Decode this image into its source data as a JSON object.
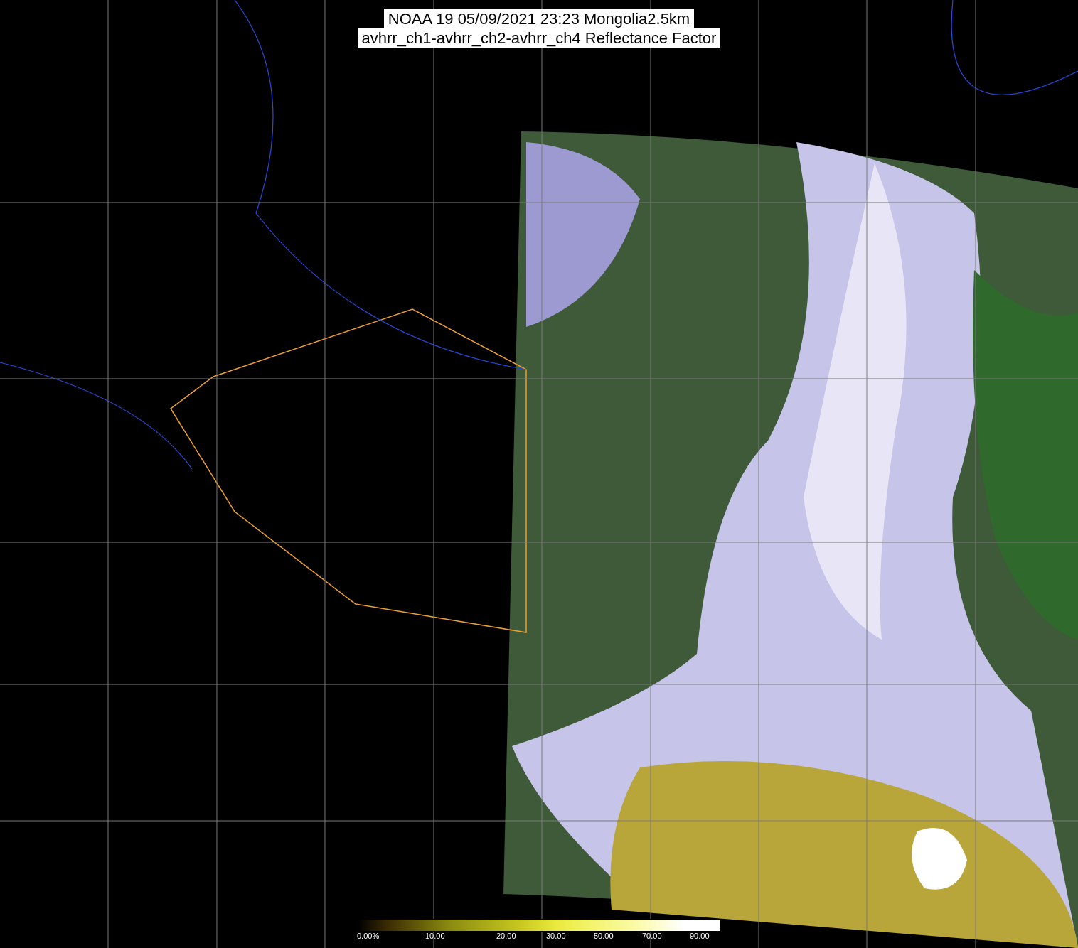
{
  "title_lines": [
    "NOAA 19 05/09/2021 23:23 Mongolia2.5km",
    "avhrr_ch1-avhrr_ch2-avhrr_ch4 Reflectance Factor"
  ],
  "colorbar": {
    "labels": [
      "0.00%",
      "10.00",
      "20.00",
      "30.00",
      "50.00",
      "70.00",
      "90.00"
    ]
  }
}
